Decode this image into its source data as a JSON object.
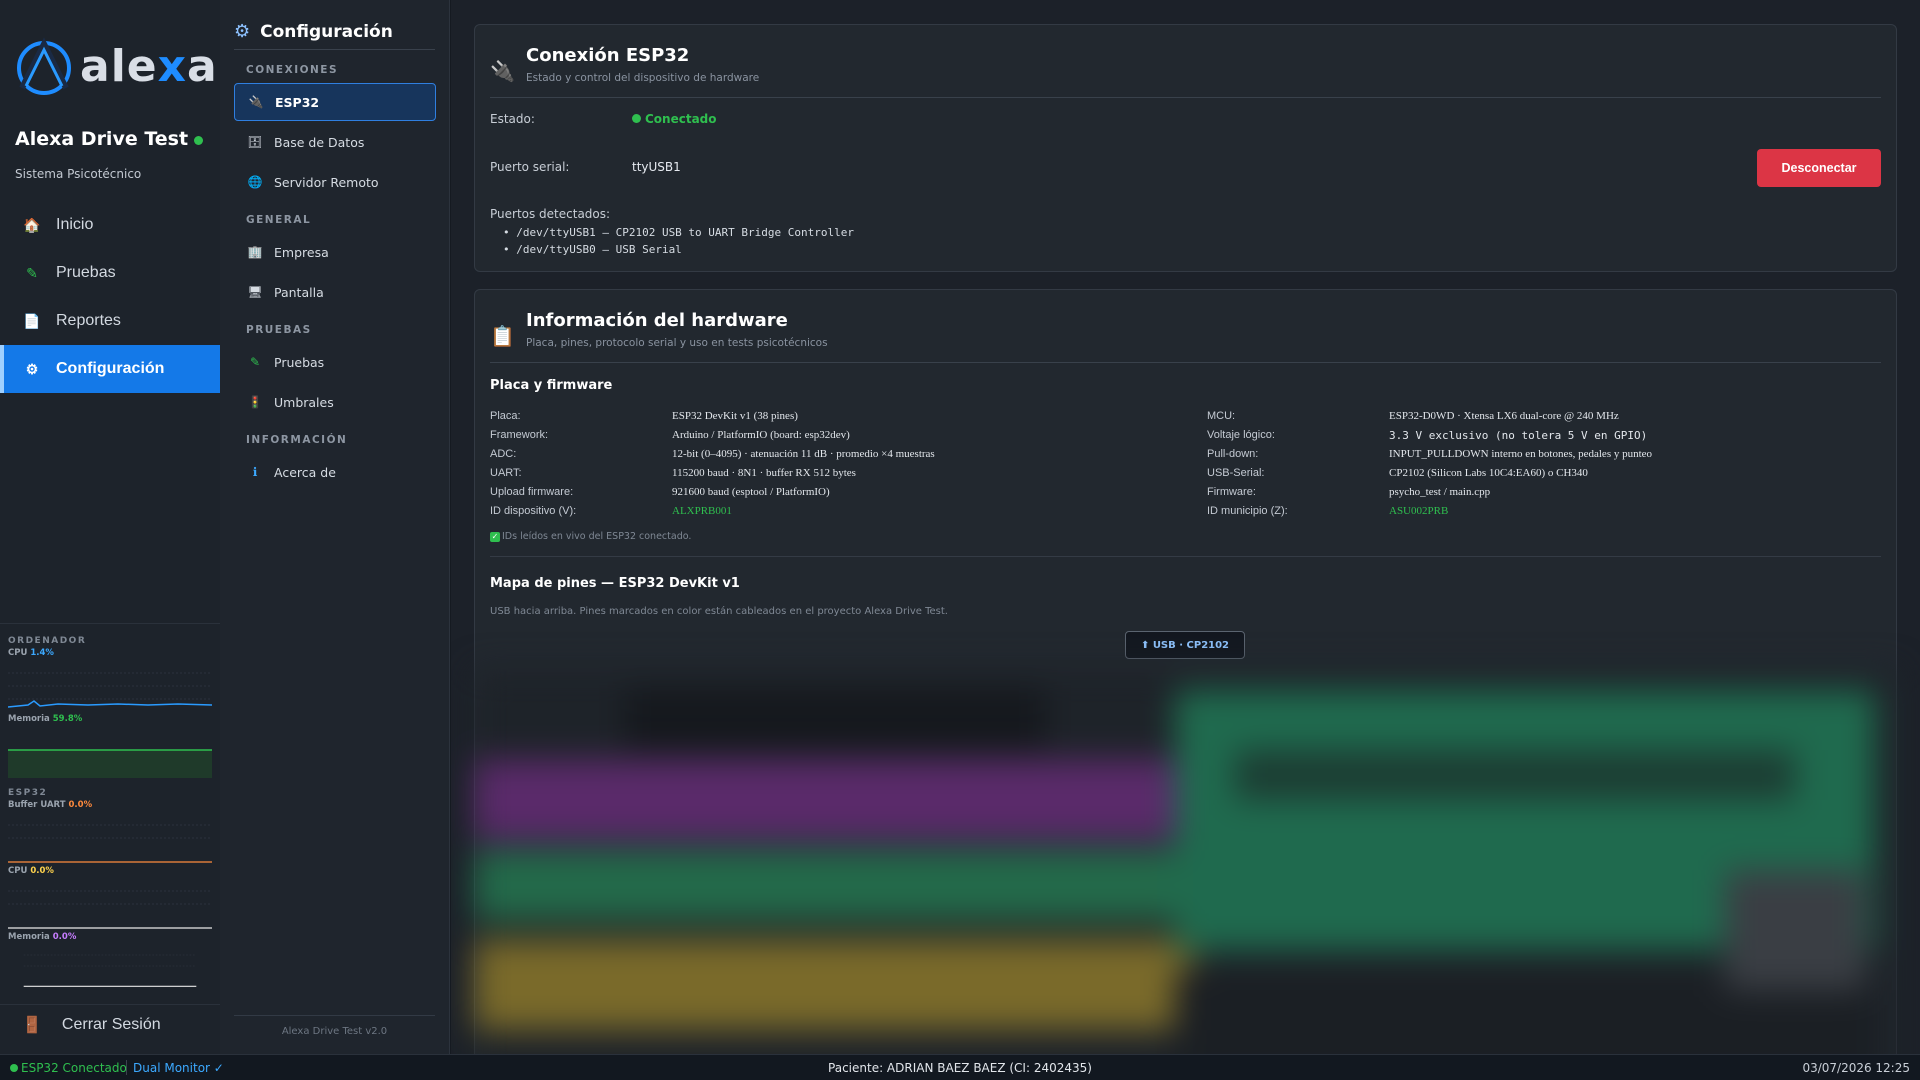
{
  "brand": {
    "logo_text_a": "ale",
    "logo_text_x": "x",
    "logo_text_b": "a",
    "accent": "#1479e8"
  },
  "sidebar": {
    "app_title": "Alexa Drive Test",
    "app_subtitle": "Sistema Psicotécnico",
    "items": [
      {
        "label": "Inicio",
        "icon": "home-icon"
      },
      {
        "label": "Pruebas",
        "icon": "pencil-icon"
      },
      {
        "label": "Reportes",
        "icon": "document-icon"
      },
      {
        "label": "Configuración",
        "icon": "gear-icon",
        "active": true
      }
    ],
    "monitor": {
      "computer_heading": "ORDENADOR",
      "cpu_label": "CPU",
      "cpu_value": "1.4%",
      "mem_label": "Memoria",
      "mem_value": "59.8%",
      "esp_heading": "ESP32",
      "uart_label": "Buffer UART",
      "uart_value": "0.0%",
      "esp_cpu_label": "CPU",
      "esp_cpu_value": "0.0%",
      "esp_mem_label": "Memoria",
      "esp_mem_value": "0.0%"
    },
    "logout_label": "Cerrar Sesión"
  },
  "config": {
    "title": "Configuración",
    "sections": {
      "connections": "CONEXIONES",
      "general": "GENERAL",
      "tests": "PRUEBAS",
      "info": "INFORMACIÓN"
    },
    "items": {
      "esp32": "ESP32",
      "database": "Base de Datos",
      "remote": "Servidor Remoto",
      "company": "Empresa",
      "screen": "Pantalla",
      "tests": "Pruebas",
      "thresholds": "Umbrales",
      "about": "Acerca de"
    },
    "footer": "Alexa Drive Test v2.0"
  },
  "connection": {
    "title": "Conexión ESP32",
    "subtitle": "Estado y control del dispositivo de hardware",
    "status_label": "Estado:",
    "status_value": "Conectado",
    "port_label": "Puerto serial:",
    "port_value": "ttyUSB1",
    "disconnect_label": "Desconectar",
    "detected_label": "Puertos detectados:",
    "detected_ports": [
      "• /dev/ttyUSB1 — CP2102 USB to UART Bridge Controller",
      "• /dev/ttyUSB0 — USB Serial"
    ]
  },
  "hardware": {
    "title": "Información del hardware",
    "subtitle": "Placa, pines, protocolo serial y uso en tests psicotécnicos",
    "board_heading": "Placa y firmware",
    "left": [
      {
        "label": "Placa:",
        "value": "ESP32 DevKit v1 (38 pines)"
      },
      {
        "label": "Framework:",
        "value": "Arduino / PlatformIO (board: esp32dev)"
      },
      {
        "label": "ADC:",
        "value": "12-bit (0–4095) · atenuación 11 dB · promedio ×4 muestras"
      },
      {
        "label": "UART:",
        "value": "115200 baud · 8N1 · buffer RX 512 bytes"
      },
      {
        "label": "Upload firmware:",
        "value": "921600 baud (esptool / PlatformIO)"
      },
      {
        "label": "ID dispositivo (V):",
        "value": "ALXPRB001"
      }
    ],
    "right": [
      {
        "label": "MCU:",
        "value": "ESP32-D0WD · Xtensa LX6 dual-core @ 240 MHz"
      },
      {
        "label": "Voltaje lógico:",
        "value": "3.3 V exclusivo (no tolera 5 V en GPIO)"
      },
      {
        "label": "Pull-down:",
        "value": "INPUT_PULLDOWN interno en botones, pedales y punteo"
      },
      {
        "label": "USB-Serial:",
        "value": "CP2102 (Silicon Labs 10C4:EA60) o CH340"
      },
      {
        "label": "Firmware:",
        "value": "psycho_test / main.cpp"
      },
      {
        "label": "ID municipio (Z):",
        "value": "ASU002PRB"
      }
    ],
    "live_note": "IDs leídos en vivo del ESP32 conectado.",
    "pinmap_heading": "Mapa de pines — ESP32 DevKit v1",
    "pinmap_note": "USB hacia arriba. Pines marcados en color están cableados en el proyecto Alexa Drive Test.",
    "usb_chip": "⬆ USB · CP2102"
  },
  "statusbar": {
    "esp_status": "ESP32 Conectado",
    "dual_monitor": "Dual Monitor ✓",
    "patient": "Paciente: ADRIAN BAEZ BAEZ (CI: 2402435)",
    "datetime": "03/07/2026 12:25"
  }
}
